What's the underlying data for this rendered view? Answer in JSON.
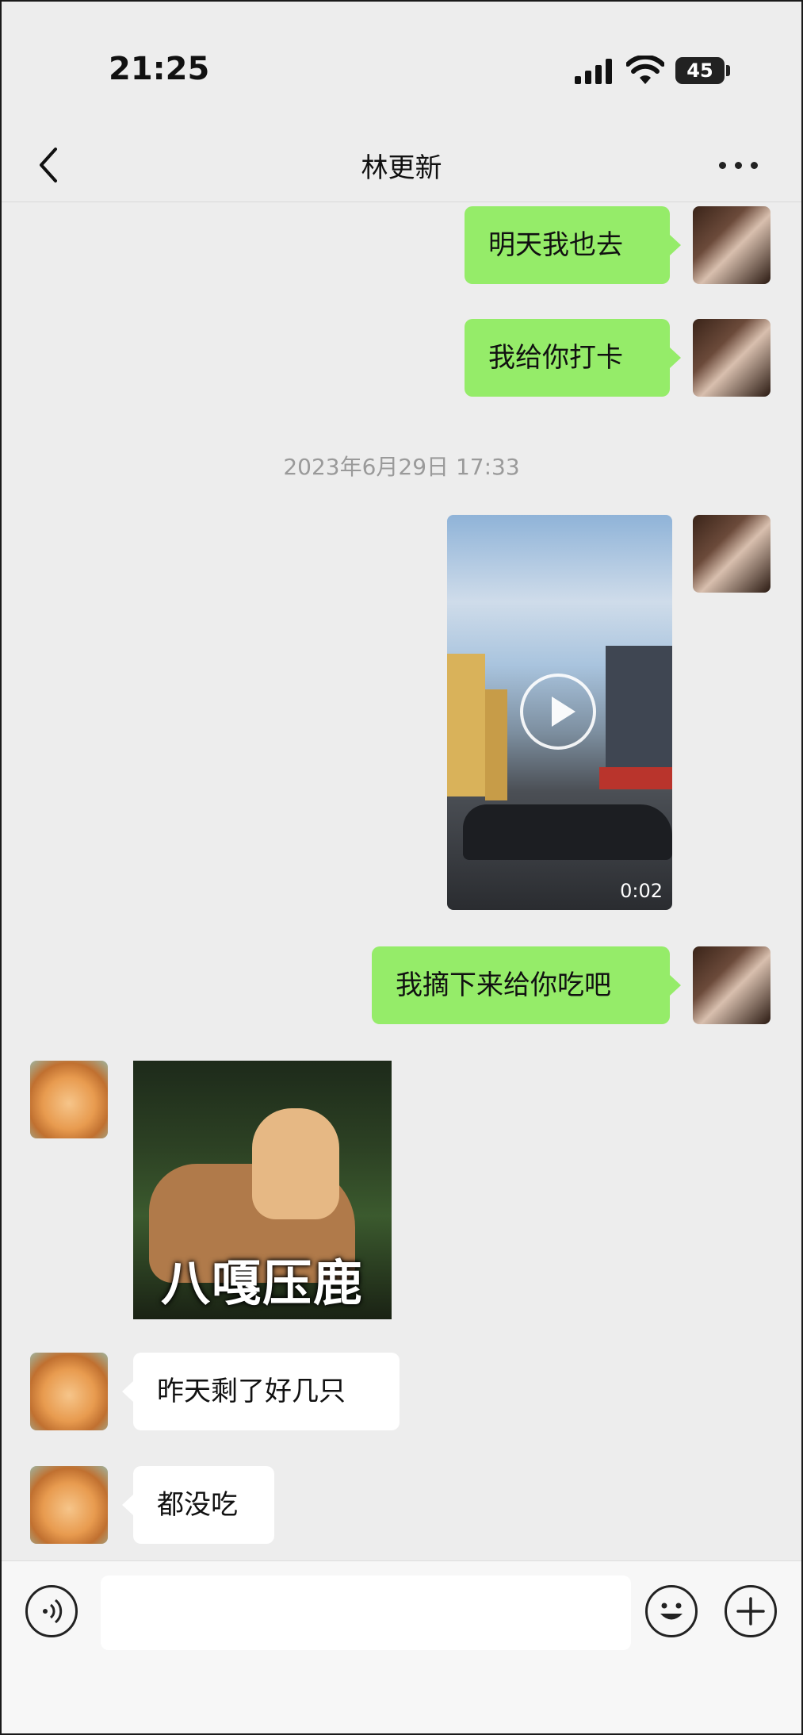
{
  "status_bar": {
    "time": "21:25",
    "battery": "45"
  },
  "nav": {
    "title": "林更新"
  },
  "messages": {
    "m1": "明天我也去",
    "m2": "我给你打卡",
    "timestamp": "2023年6月29日 17:33",
    "video_duration": "0:02",
    "m3": "我摘下来给你吃吧",
    "sticker_caption": "八嘎压鹿",
    "m4": "昨天剩了好几只",
    "m5": "都没吃"
  },
  "colors": {
    "sent_bubble": "#95ec69",
    "received_bubble": "#ffffff",
    "background": "#ededed"
  }
}
